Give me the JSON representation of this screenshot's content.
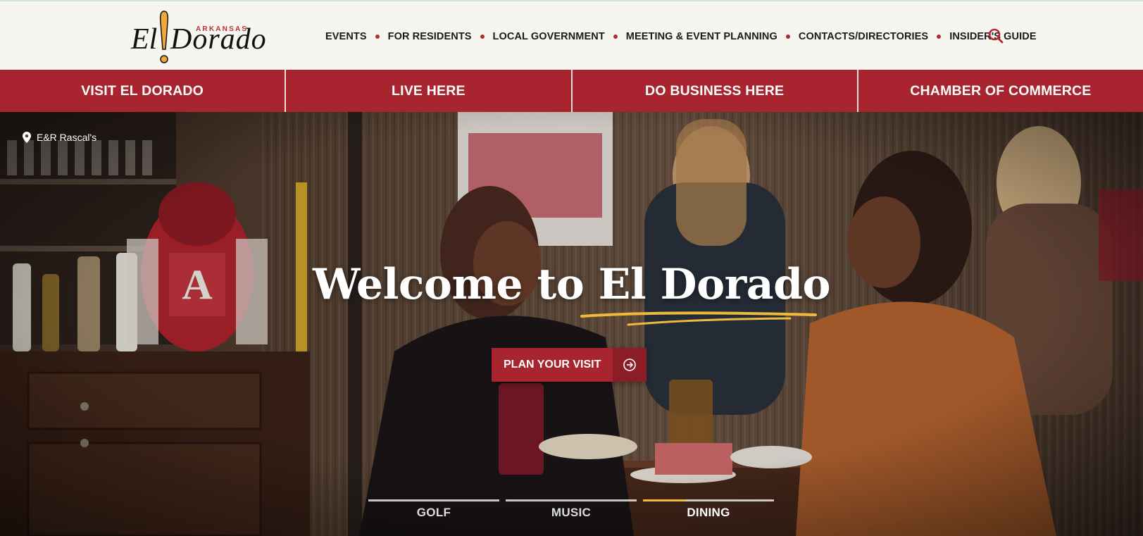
{
  "logo": {
    "state": "ARKANSAS",
    "el": "El",
    "name": "Dorado"
  },
  "colors": {
    "brand_red": "#a8252f",
    "accent_gold": "#f0b93a",
    "header_bg": "#f7f5f0"
  },
  "topnav": {
    "items": [
      "EVENTS",
      "FOR RESIDENTS",
      "LOCAL GOVERNMENT",
      "MEETING & EVENT PLANNING",
      "CONTACTS/DIRECTORIES",
      "INSIDER'S GUIDE"
    ],
    "search_icon": "search-icon"
  },
  "mainnav": {
    "items": [
      "VISIT EL DORADO",
      "LIVE HERE",
      "DO BUSINESS HERE",
      "CHAMBER OF COMMERCE"
    ]
  },
  "hero": {
    "location": "E&R Rascal's",
    "location_icon": "map-pin-icon",
    "headline": "Welcome to El Dorado",
    "cta_label": "PLAN YOUR VISIT",
    "cta_icon": "arrow-circle-right-icon",
    "slides": [
      {
        "label": "GOLF",
        "progress": 0,
        "active": false
      },
      {
        "label": "MUSIC",
        "progress": 0,
        "active": false
      },
      {
        "label": "DINING",
        "progress": 0.32,
        "active": true
      }
    ]
  }
}
